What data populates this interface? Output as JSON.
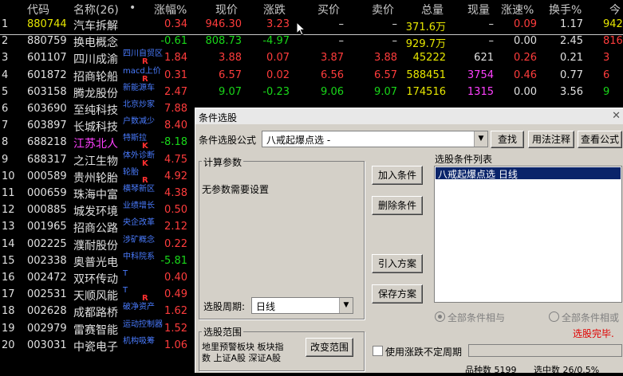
{
  "header": {
    "code": "代码",
    "name": "名称(26)",
    "dot": "•",
    "change_pct": "涨幅%",
    "price": "现价",
    "change": "涨跌",
    "buy": "买价",
    "sell": "卖价",
    "volume": "总量",
    "cur_vol": "现量",
    "speed": "涨速%",
    "turnover": "换手%",
    "extra": "今"
  },
  "rows": [
    {
      "idx": "1",
      "code": "880744",
      "name": "汽车拆解",
      "sub": "",
      "mark": "",
      "chg": "0.34",
      "price": "946.30",
      "diff": "3.23",
      "buy": "–",
      "sell": "–",
      "vol": "371.6万",
      "now": "–",
      "spd": "0.09",
      "turn": "1.17",
      "x": "942"
    },
    {
      "idx": "2",
      "code": "880759",
      "name": "换电概念",
      "sub": "",
      "mark": "",
      "chg": "-0.61",
      "price": "808.73",
      "diff": "-4.97",
      "buy": "–",
      "sell": "–",
      "vol": "929.7万",
      "now": "–",
      "spd": "0.00",
      "turn": "2.45",
      "x": "816"
    },
    {
      "idx": "3",
      "code": "601107",
      "name": "四川成渝",
      "sub": "四川自贸区",
      "mark": "R",
      "chg": "1.84",
      "price": "3.88",
      "diff": "0.07",
      "buy": "3.87",
      "sell": "3.88",
      "vol": "45222",
      "now": "621",
      "spd": "0.26",
      "turn": "0.21",
      "x": "3"
    },
    {
      "idx": "4",
      "code": "601872",
      "name": "招商轮船",
      "sub": "macd上价",
      "mark": "R",
      "chg": "0.31",
      "price": "6.57",
      "diff": "0.02",
      "buy": "6.56",
      "sell": "6.57",
      "vol": "588451",
      "now": "3754",
      "spd": "0.46",
      "turn": "0.77",
      "x": "6"
    },
    {
      "idx": "5",
      "code": "603158",
      "name": "腾龙股份",
      "sub": "新能源车",
      "mark": "",
      "chg": "2.47",
      "price": "9.07",
      "diff": "-0.23",
      "buy": "9.06",
      "sell": "9.07",
      "vol": "174516",
      "now": "1315",
      "spd": "0.00",
      "turn": "3.56",
      "x": "9"
    },
    {
      "idx": "6",
      "code": "603690",
      "name": "至纯科技",
      "sub": "北京炒家",
      "mark": "",
      "chg": "7.88",
      "price": "",
      "diff": "",
      "buy": "",
      "sell": "",
      "vol": "",
      "now": "",
      "spd": "",
      "turn": "",
      "x": ""
    },
    {
      "idx": "7",
      "code": "603897",
      "name": "长城科技",
      "sub": "户数减少",
      "mark": "",
      "chg": "8.40",
      "price": "",
      "diff": "",
      "buy": "",
      "sell": "",
      "vol": "",
      "now": "",
      "spd": "",
      "turn": "",
      "x": ""
    },
    {
      "idx": "8",
      "code": "688218",
      "name": "江苏北人",
      "sub": "特斯拉",
      "mark": "K",
      "chg": "-8.18",
      "price": "",
      "diff": "",
      "buy": "",
      "sell": "",
      "vol": "",
      "now": "",
      "spd": "",
      "turn": "",
      "x": ""
    },
    {
      "idx": "9",
      "code": "688317",
      "name": "之江生物",
      "sub": "体外诊断",
      "mark": "K",
      "chg": "4.75",
      "price": "",
      "diff": "",
      "buy": "",
      "sell": "",
      "vol": "",
      "now": "",
      "spd": "",
      "turn": "",
      "x": ""
    },
    {
      "idx": "10",
      "code": "000589",
      "name": "贵州轮胎",
      "sub": "轮胎",
      "mark": "R",
      "chg": "4.92",
      "price": "",
      "diff": "",
      "buy": "",
      "sell": "",
      "vol": "",
      "now": "",
      "spd": "",
      "turn": "",
      "x": ""
    },
    {
      "idx": "11",
      "code": "000659",
      "name": "珠海中富",
      "sub": "横琴新区",
      "mark": "",
      "chg": "4.38",
      "price": "",
      "diff": "",
      "buy": "",
      "sell": "",
      "vol": "",
      "now": "",
      "spd": "",
      "turn": "",
      "x": ""
    },
    {
      "idx": "12",
      "code": "000885",
      "name": "城发环境",
      "sub": "业绩增长",
      "mark": "",
      "chg": "0.50",
      "price": "",
      "diff": "",
      "buy": "",
      "sell": "",
      "vol": "",
      "now": "",
      "spd": "",
      "turn": "",
      "x": ""
    },
    {
      "idx": "13",
      "code": "001965",
      "name": "招商公路",
      "sub": "央企改革",
      "mark": "",
      "chg": "2.12",
      "price": "",
      "diff": "",
      "buy": "",
      "sell": "",
      "vol": "",
      "now": "",
      "spd": "",
      "turn": "",
      "x": ""
    },
    {
      "idx": "14",
      "code": "002225",
      "name": "濮耐股份",
      "sub": "涉矿概念",
      "mark": "",
      "chg": "0.22",
      "price": "",
      "diff": "",
      "buy": "",
      "sell": "",
      "vol": "",
      "now": "",
      "spd": "",
      "turn": "",
      "x": ""
    },
    {
      "idx": "15",
      "code": "002338",
      "name": "奥普光电",
      "sub": "中科院系",
      "mark": "",
      "chg": "-5.81",
      "price": "",
      "diff": "",
      "buy": "",
      "sell": "",
      "vol": "",
      "now": "",
      "spd": "",
      "turn": "",
      "x": ""
    },
    {
      "idx": "16",
      "code": "002472",
      "name": "双环传动",
      "sub": "T",
      "mark": "",
      "chg": "0.40",
      "price": "",
      "diff": "",
      "buy": "",
      "sell": "",
      "vol": "",
      "now": "",
      "spd": "",
      "turn": "",
      "x": ""
    },
    {
      "idx": "17",
      "code": "002531",
      "name": "天顺风能",
      "sub": "T",
      "mark": "R",
      "chg": "0.49",
      "price": "",
      "diff": "",
      "buy": "",
      "sell": "",
      "vol": "",
      "now": "",
      "spd": "",
      "turn": "",
      "x": ""
    },
    {
      "idx": "18",
      "code": "002628",
      "name": "成都路桥",
      "sub": "破净资产",
      "mark": "",
      "chg": "1.62",
      "price": "",
      "diff": "",
      "buy": "",
      "sell": "",
      "vol": "",
      "now": "",
      "spd": "",
      "turn": "",
      "x": ""
    },
    {
      "idx": "19",
      "code": "002979",
      "name": "雷赛智能",
      "sub": "运动控制器",
      "mark": "",
      "chg": "1.52",
      "price": "",
      "diff": "",
      "buy": "",
      "sell": "",
      "vol": "",
      "now": "",
      "spd": "",
      "turn": "",
      "x": ""
    },
    {
      "idx": "20",
      "code": "003031",
      "name": "中瓷电子",
      "sub": "机构吸筹",
      "mark": "",
      "chg": "1.06",
      "price": "",
      "diff": "",
      "buy": "",
      "sell": "",
      "vol": "",
      "now": "",
      "spd": "",
      "turn": "",
      "x": ""
    }
  ],
  "dialog": {
    "title": "条件选股",
    "formula_label": "条件选股公式",
    "formula_value": "八戒起爆点选 -",
    "find_btn": "查找",
    "usage_btn": "用法注释",
    "view_btn": "查看公式",
    "calc_group": "计算参数",
    "no_params": "无参数需要设置",
    "period_label": "选股周期:",
    "period_value": "日线",
    "add_btn": "加入条件",
    "del_btn": "删除条件",
    "import_btn": "引入方案",
    "save_btn": "保存方案",
    "list_title": "选股条件列表",
    "list_item": "八戒起爆点选  日线",
    "radio_and": "全部条件相与",
    "radio_or": "全部条件相或",
    "done": "选股完毕.",
    "range_group": "选股范围",
    "range_text_1": "地里预警板块  板块指",
    "range_text_2": "数 上证A股 深证A股",
    "range_btn": "改变范围",
    "use_uncertain": "使用涨跌不定周期",
    "count": "品种数 5199",
    "selected": "选中数 26/0.5%"
  },
  "colors": {
    "up": "#ff3c3c",
    "down": "#19d819",
    "volume": "#e6e600",
    "selection": "#0a246a"
  }
}
